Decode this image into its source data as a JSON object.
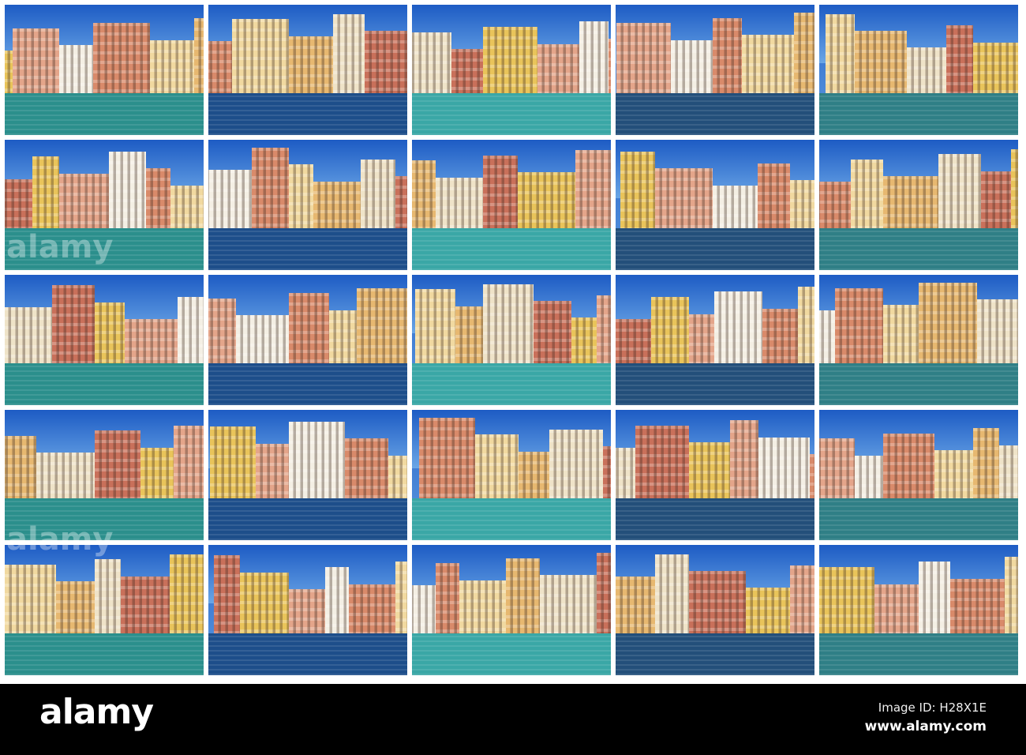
{
  "collage": {
    "rows": 5,
    "columns": 5
  },
  "watermark": "alamy",
  "footer": {
    "logo": "alamy",
    "image_id": "Image ID: H28X1E",
    "website": "www.alamy.com"
  },
  "colors": {
    "sky": "#1f6fd6",
    "water_teal": "#2aa5a8",
    "water_blue": "#1c4f8c",
    "footer_bg": "#000000"
  }
}
